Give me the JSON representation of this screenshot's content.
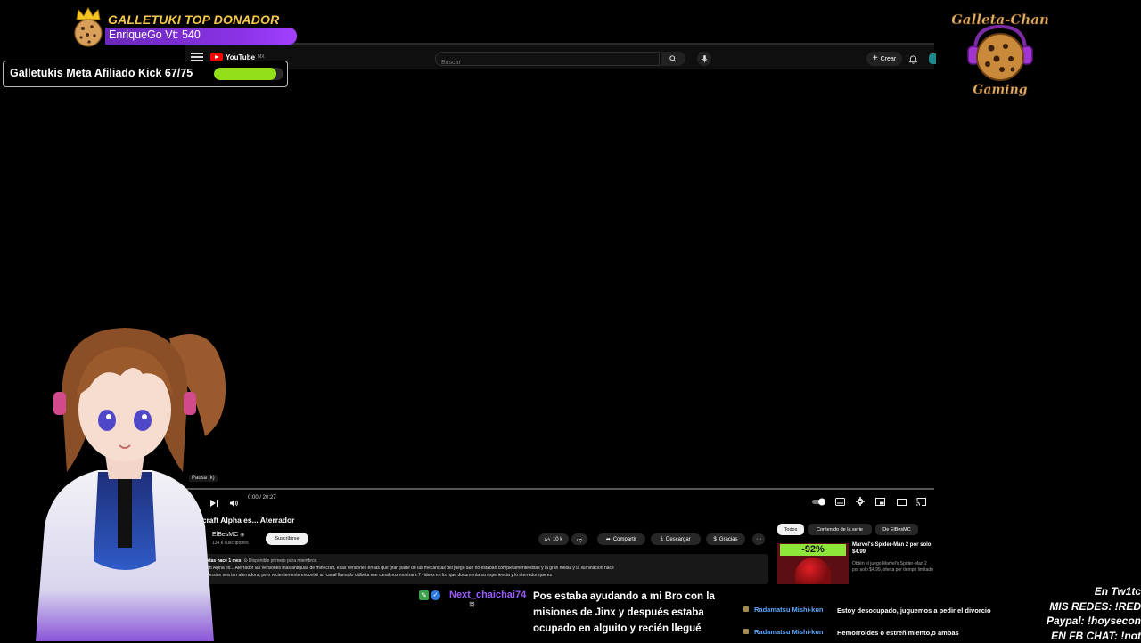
{
  "donor": {
    "title": "GALLETUKI TOP DONADOR",
    "name": "EnriqueGo Vt: 540"
  },
  "goal": {
    "text": "Galletukis Meta Afiliado Kick 67/75",
    "current": 67,
    "target": 75
  },
  "brand": {
    "line1": "Galleta-Chan",
    "line2": "Gaming"
  },
  "youtube": {
    "logo_text": "YouTube",
    "region": "MX",
    "search_placeholder": "Buscar",
    "create_label": "Crear",
    "tooltip": "Pausa (k)",
    "time": "0:00 / 20:27",
    "video_title": "ecraft Alpha es... Aterrador",
    "channel": "ElBesMC",
    "channel_subs": "134 k suscriptores",
    "subscribe_label": "Suscribirse",
    "likes": "10 k",
    "share_label": "Compartir",
    "download_label": "Descargar",
    "thanks_label": "Gracias",
    "desc_meta": "vistas  hace 1 mes",
    "desc_members": "Disponible primero para miembros",
    "desc_line1": "craft Alpha es... Aterrador las versiones mas antiguas de minecraft, esas versiones en las que gran parte de las mecánicas del juego aun no estaban completamente listas y la gran niebla y la iluminación hace",
    "desc_line2": "a versión sea tan aterradora, pero recientemente encontré un canal llamado oldbeta ese canal nos mostrara 7 videos en los que documenta su experiencia y lo aterrador que es",
    "chips": [
      "Todos",
      "Contenido de la serie",
      "De ElBesMC"
    ],
    "ad_discount": "-92%",
    "ad_title": "Marvel's Spider-Man 2 por solo $4.99",
    "ad_sub": "Obtén el juego Marvel's Spider-Man 2 por solo $4.99, oferta por tiempo limitado"
  },
  "chat": {
    "main": {
      "user": "Next_chaichai74",
      "message": "Pos estaba ayudando a mi Bro con la misiones de Jinx y después estaba ocupado en alguito y recién llegué"
    },
    "side": [
      {
        "user": "Radamatsu Mishi-kun",
        "message": "Estoy desocupado, juguemos a pedir el divorcio"
      },
      {
        "user": "Radamatsu Mishi-kun",
        "message": "Hemorroides o estreñimiento,o ambas"
      }
    ]
  },
  "right_info": [
    "En Tw1tc",
    "MIS REDES: !RED",
    "Paypal: !hoysecon",
    "EN FB CHAT: !not"
  ],
  "colors": {
    "goal_fill": "#93e01a",
    "donor_bar": "#8a33e6",
    "donor_title": "#f7c94b",
    "chat_user": "#9b5cff",
    "side_user": "#5aa7ff"
  }
}
